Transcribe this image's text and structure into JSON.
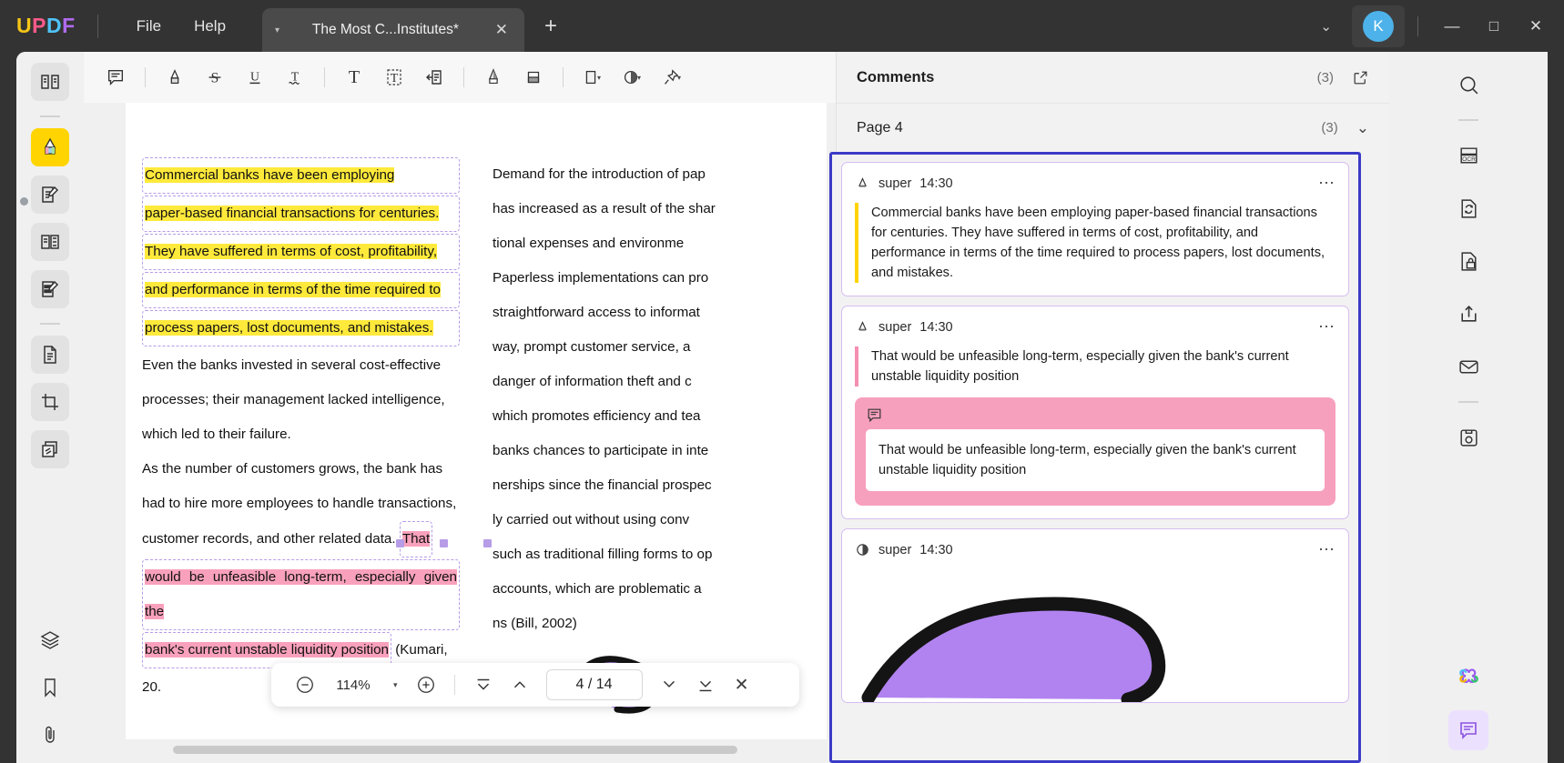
{
  "titlebar": {
    "logo": [
      "U",
      "P",
      "D",
      "F"
    ],
    "menus": [
      {
        "label": "File",
        "name": "menu-file"
      },
      {
        "label": "Help",
        "name": "menu-help"
      }
    ],
    "tab": {
      "title": "The Most C...Institutes*",
      "close_label": "✕",
      "caret": "▾"
    },
    "new_tab_label": "+",
    "chevron": "⌄",
    "avatar_initial": "K",
    "window_controls": {
      "minimize": "—",
      "maximize": "□",
      "close": "✕"
    }
  },
  "left_rail": {
    "items": [
      {
        "name": "sidebar-reader-icon",
        "title": "Reader"
      },
      {
        "name": "sidebar-highlighter-icon",
        "title": "Comment",
        "active": true
      },
      {
        "name": "sidebar-edit-pdf-icon",
        "title": "Edit PDF"
      },
      {
        "name": "sidebar-organize-pages-icon",
        "title": "Organize Pages"
      },
      {
        "name": "sidebar-form-icon",
        "title": "Form"
      },
      {
        "name": "sidebar-convert-icon",
        "title": "Convert"
      },
      {
        "name": "sidebar-crop-icon",
        "title": "Crop"
      },
      {
        "name": "sidebar-batch-icon",
        "title": "Batch"
      },
      {
        "name": "sidebar-layers-icon",
        "title": "Layers"
      },
      {
        "name": "sidebar-bookmark-icon",
        "title": "Bookmark"
      },
      {
        "name": "sidebar-attachment-icon",
        "title": "Attachment"
      }
    ]
  },
  "annotation_toolbar": {
    "tools": [
      {
        "name": "sticky-note-tool",
        "title": "Note"
      },
      {
        "name": "highlight-tool",
        "title": "Highlight"
      },
      {
        "name": "strikethrough-tool",
        "title": "Strikethrough"
      },
      {
        "name": "underline-tool",
        "title": "Underline"
      },
      {
        "name": "squiggly-tool",
        "title": "Squiggly"
      },
      {
        "name": "text-tool",
        "title": "Text"
      },
      {
        "name": "text-box-tool",
        "title": "Text Box"
      },
      {
        "name": "callout-tool",
        "title": "Callout"
      },
      {
        "name": "pencil-tool",
        "title": "Pencil"
      },
      {
        "name": "eraser-tool",
        "title": "Eraser"
      },
      {
        "name": "shape-tool",
        "title": "Shapes"
      },
      {
        "name": "stamp-tool",
        "title": "Stamp"
      },
      {
        "name": "pin-tool",
        "title": "Pin"
      }
    ]
  },
  "document": {
    "left_column": {
      "highlight_yellow_lines": [
        "Commercial   banks   have   been   employing",
        "paper-based  financial  transactions  for  centuries.",
        "They  have  suffered  in  terms  of  cost,  profitability,",
        "and  performance  in  terms  of  the  time  required  to",
        "process  papers,  lost  documents,  and  mistakes."
      ],
      "plain_paragraph_1": [
        "Even the banks invested in several cost-effective",
        "processes; their management lacked intelligence,",
        "which led to their failure."
      ],
      "plain_paragraph_2": [
        "As the number of customers grows, the bank has",
        "had to hire more employees to handle transactions,"
      ],
      "mixed_line_prefix": "customer  records,  and  other  related  data. ",
      "mixed_line_highlight": "That",
      "highlight_pink_lines": [
        "would be unfeasible long-term, especially given the",
        "bank's current unstable liquidity position"
      ],
      "trailing_text": " (Kumari,",
      "last_line": "20."
    },
    "right_column": [
      "Demand for the introduction of pap",
      "has increased as a result of the shar",
      "tional   expenses   and   environme",
      "Paperless implementations can pro",
      "straightforward access to informat",
      "way,  prompt  customer  service,  a",
      "danger  of  information  theft  and  c",
      "which promotes efficiency and tea",
      "banks chances to participate in inte",
      "nerships since the financial prospec",
      "ly  carried  out  without  using  conv",
      "such as traditional filling forms to op",
      "accounts,  which  are  problematic  a",
      "ns (Bill, 2002)"
    ]
  },
  "nav_toolbar": {
    "zoom_out": "−",
    "zoom_value": "114%",
    "zoom_caret": "▾",
    "zoom_in": "+",
    "first_page_title": "First Page",
    "prev_page_title": "Previous Page",
    "page_current": "4",
    "page_separator": "/",
    "page_total": "14",
    "page_display": "4 / 14",
    "next_page_title": "Next Page",
    "last_page_title": "Last Page",
    "close": "✕"
  },
  "comments_panel": {
    "title": "Comments",
    "count": "(3)",
    "expand_icon": "expand-icon",
    "page_label": "Page 4",
    "page_count": "(3)",
    "collapse_caret": "⌄",
    "cards": [
      {
        "icon": "highlight-marker-icon",
        "author": "super",
        "time": "14:30",
        "menu": "⋯",
        "accent": "#ffd400",
        "quote": "Commercial banks have been employing paper-based financial transactions for centuries. They have suffered in terms of cost, profitability, and performance in terms of the time required to process papers, lost documents, and mistakes."
      },
      {
        "icon": "highlight-marker-icon",
        "author": "super",
        "time": "14:30",
        "menu": "⋯",
        "accent": "#f48fb1",
        "quote": "That would be unfeasible long-term, especially given the bank's current unstable liquidity position",
        "reply": {
          "icon": "comment-bubble-icon",
          "text": "That would be unfeasible long-term, especially given the bank's current unstable liquidity position"
        }
      },
      {
        "icon": "ink-drawing-icon",
        "author": "super",
        "time": "14:30",
        "menu": "⋯",
        "ink_color": "#b183f0",
        "ink_stroke": "#141414"
      }
    ]
  },
  "right_rail": {
    "items": [
      {
        "name": "search-icon",
        "title": "Search"
      },
      {
        "name": "ocr-icon",
        "title": "OCR"
      },
      {
        "name": "convert-file-icon",
        "title": "Convert"
      },
      {
        "name": "protect-lock-icon",
        "title": "Protect"
      },
      {
        "name": "share-icon",
        "title": "Share"
      },
      {
        "name": "email-icon",
        "title": "Email"
      },
      {
        "name": "save-disk-icon",
        "title": "Save"
      },
      {
        "name": "ai-assistant-icon",
        "title": "AI Assistant"
      },
      {
        "name": "comments-panel-icon",
        "title": "Comments",
        "active": true
      }
    ]
  }
}
